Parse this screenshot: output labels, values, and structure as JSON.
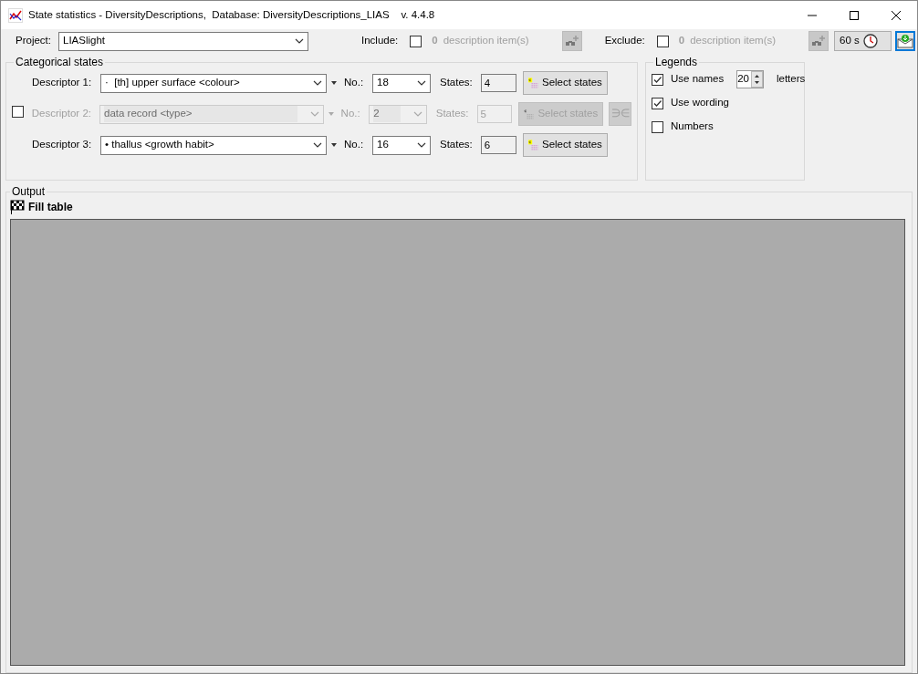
{
  "window": {
    "title": "State statistics - DiversityDescriptions,  Database: DiversityDescriptions_LIAS    v. 4.4.8"
  },
  "toolbar": {
    "project_label": "Project:",
    "project": "LIASlight",
    "include": {
      "label": "Include:",
      "checked": false,
      "count": "0",
      "unit": "description item(s)"
    },
    "exclude": {
      "label": "Exclude:",
      "checked": false,
      "count": "0",
      "unit": "description item(s)"
    },
    "timeout": "60 s"
  },
  "categorical_states": {
    "title": "Categorical states",
    "descriptors": [
      {
        "kind": "fixed",
        "label": "Descriptor 1:",
        "enabled": true,
        "value": "·  [th] upper surface <colour>",
        "no_label": "No.:",
        "no": "18",
        "states_label": "States:",
        "states": "4",
        "button": "Select states"
      },
      {
        "kind": "optional",
        "checked": false,
        "label": "Descriptor 2:",
        "enabled": false,
        "value": "data record <type>",
        "no_label": "No.:",
        "no": "2",
        "states_label": "States:",
        "states": "5",
        "button": "Select states",
        "extra_button": "∋∈"
      },
      {
        "kind": "fixed",
        "label": "Descriptor 3:",
        "enabled": true,
        "value": "• thallus <growth habit>",
        "no_label": "No.:",
        "no": "16",
        "states_label": "States:",
        "states": "6",
        "button": "Select states"
      }
    ]
  },
  "legends": {
    "title": "Legends",
    "options": [
      {
        "kind": "spin",
        "label": "Use names",
        "checked": true,
        "value": "20",
        "unit": "letters"
      },
      {
        "kind": "check",
        "label": "Use wording",
        "checked": true
      },
      {
        "kind": "check",
        "label": "Numbers",
        "checked": false
      }
    ]
  },
  "output": {
    "title": "Output",
    "fill_table": "Fill table"
  }
}
